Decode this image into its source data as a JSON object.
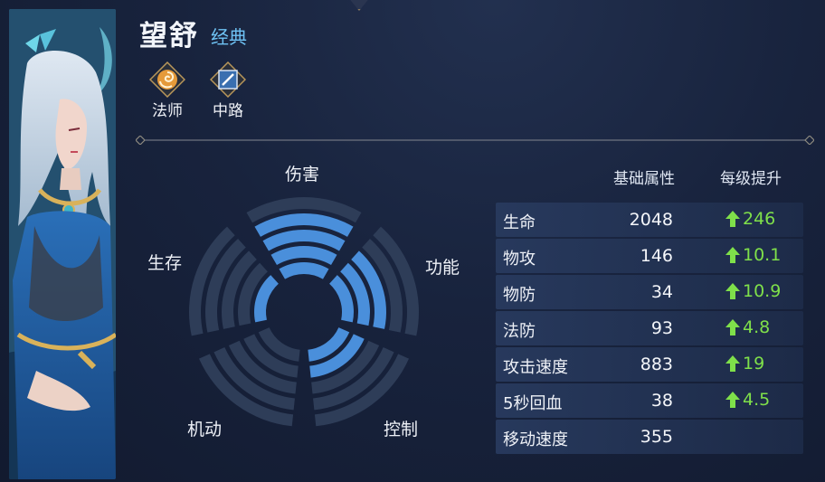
{
  "hero": {
    "name": "望舒",
    "skin": "经典"
  },
  "roles": [
    {
      "label": "法师",
      "icon": "mage-swirl-icon"
    },
    {
      "label": "中路",
      "icon": "mid-lane-icon"
    }
  ],
  "radar": {
    "labels": {
      "damage": "伤害",
      "utility": "功能",
      "control": "控制",
      "mobility": "机动",
      "survival": "生存"
    },
    "levels_filled": {
      "damage": 4,
      "utility": 3,
      "control": 2,
      "mobility": 0,
      "survival": 1
    },
    "levels_max": 5,
    "colors": {
      "filled": "#4a8fdb",
      "empty": "#2e3d58"
    }
  },
  "stats": {
    "header_base": "基础属性",
    "header_growth": "每级提升",
    "rows": [
      {
        "name": "生命",
        "value": "2048",
        "growth": "246"
      },
      {
        "name": "物攻",
        "value": "146",
        "growth": "10.1"
      },
      {
        "name": "物防",
        "value": "34",
        "growth": "10.9"
      },
      {
        "name": "法防",
        "value": "93",
        "growth": "4.8"
      },
      {
        "name": "攻击速度",
        "value": "883",
        "growth": "19"
      },
      {
        "name": "5秒回血",
        "value": "38",
        "growth": "4.5"
      },
      {
        "name": "移动速度",
        "value": "355",
        "growth": ""
      }
    ],
    "growth_color": "#7fe04a"
  }
}
